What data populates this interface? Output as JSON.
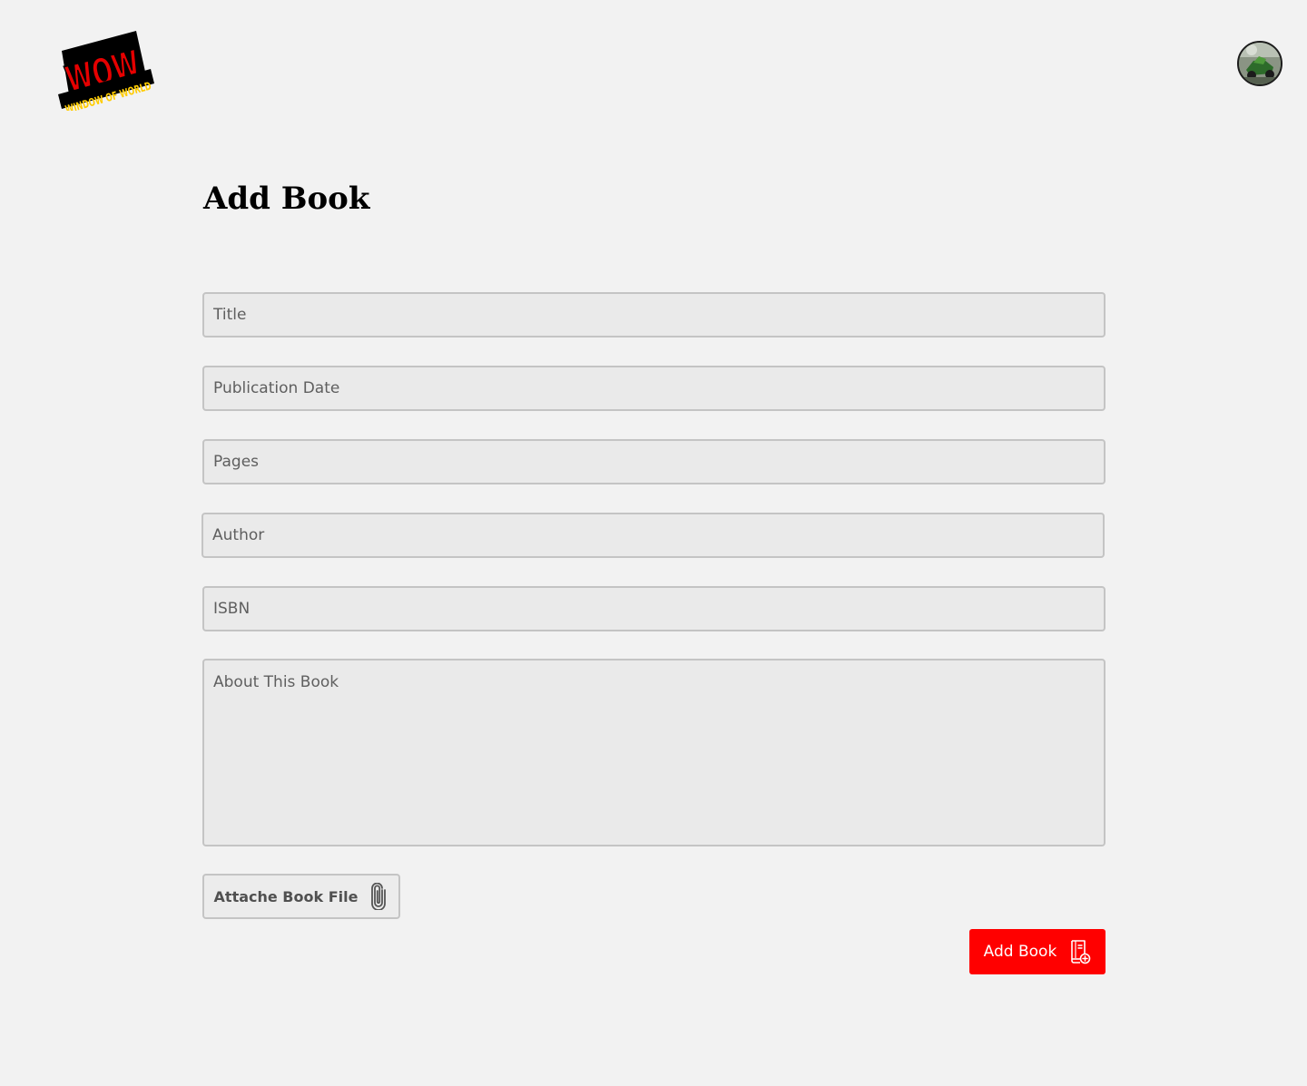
{
  "header": {
    "logo_text": "WOW",
    "logo_subtext": "WINDOW OF WORLD",
    "avatar_icon": "user-avatar"
  },
  "main": {
    "page_title": "Add Book",
    "fields": {
      "title_placeholder": "Title",
      "publication_date_placeholder": "Publication Date",
      "pages_placeholder": "Pages",
      "author_placeholder": "Author",
      "isbn_placeholder": "ISBN",
      "about_placeholder": "About This Book"
    },
    "attach_button": {
      "label": "Attache Book File",
      "icon": "paperclip-icon"
    },
    "submit_button": {
      "label": "Add Book",
      "icon": "book-add-icon"
    }
  },
  "colors": {
    "background": "#f2f2f2",
    "accent": "#ff0000",
    "field_background": "#eaeaea",
    "field_border": "#c4c4c4"
  }
}
